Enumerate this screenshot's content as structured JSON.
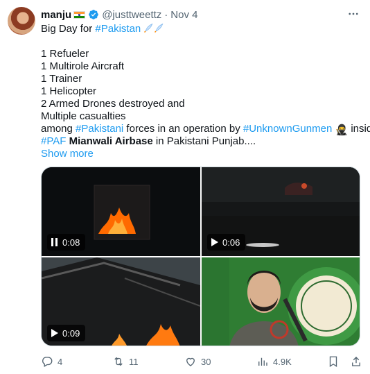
{
  "author": {
    "name": "manju",
    "handle": "@justtweettz",
    "date": "Nov 4"
  },
  "tweet": {
    "lines": [
      {
        "parts": [
          {
            "t": "Big Day for ",
            "k": "plain"
          },
          {
            "t": "#Pakistan",
            "k": "link"
          }
        ],
        "emoji": "rocket-x2"
      },
      {
        "gap": true
      },
      {
        "parts": [
          {
            "t": "1 Refueler",
            "k": "plain"
          }
        ]
      },
      {
        "parts": [
          {
            "t": "1 Multirole Aircraft",
            "k": "plain"
          }
        ]
      },
      {
        "parts": [
          {
            "t": "1 Trainer",
            "k": "plain"
          }
        ]
      },
      {
        "parts": [
          {
            "t": "1 Helicopter",
            "k": "plain"
          }
        ]
      },
      {
        "parts": [
          {
            "t": "2 Armed Drones destroyed and",
            "k": "plain"
          }
        ]
      },
      {
        "parts": [
          {
            "t": "Multiple casualties",
            "k": "plain"
          }
        ]
      },
      {
        "parts": [
          {
            "t": "among ",
            "k": "plain"
          },
          {
            "t": "#Pakistani",
            "k": "link"
          },
          {
            "t": " forces in an operation by ",
            "k": "plain"
          },
          {
            "t": "#UnknownGunmen",
            "k": "link"
          },
          {
            "t": " ",
            "k": "plain"
          },
          {
            "t": "🥷",
            "k": "emoji"
          },
          {
            "t": " inside",
            "k": "plain"
          }
        ]
      },
      {
        "parts": [
          {
            "t": "#PAF",
            "k": "link"
          },
          {
            "t": " ",
            "k": "plain"
          },
          {
            "t": "Mianwali Airbase",
            "k": "bold"
          },
          {
            "t": " in Pakistani Punjab....",
            "k": "plain"
          }
        ]
      }
    ],
    "show_more": "Show more"
  },
  "media": [
    {
      "duration": "0:08",
      "state": "pause"
    },
    {
      "duration": "0:06",
      "state": "play"
    },
    {
      "duration": "0:09",
      "state": "play"
    },
    {
      "duration": "",
      "state": "image"
    }
  ],
  "actions": {
    "replies": "4",
    "retweets": "11",
    "likes": "30",
    "views": "4.9K"
  },
  "colors": {
    "link": "#1d9bf0",
    "text": "#0f1419",
    "secondary": "#536471",
    "verified": "#1d9bf0"
  }
}
